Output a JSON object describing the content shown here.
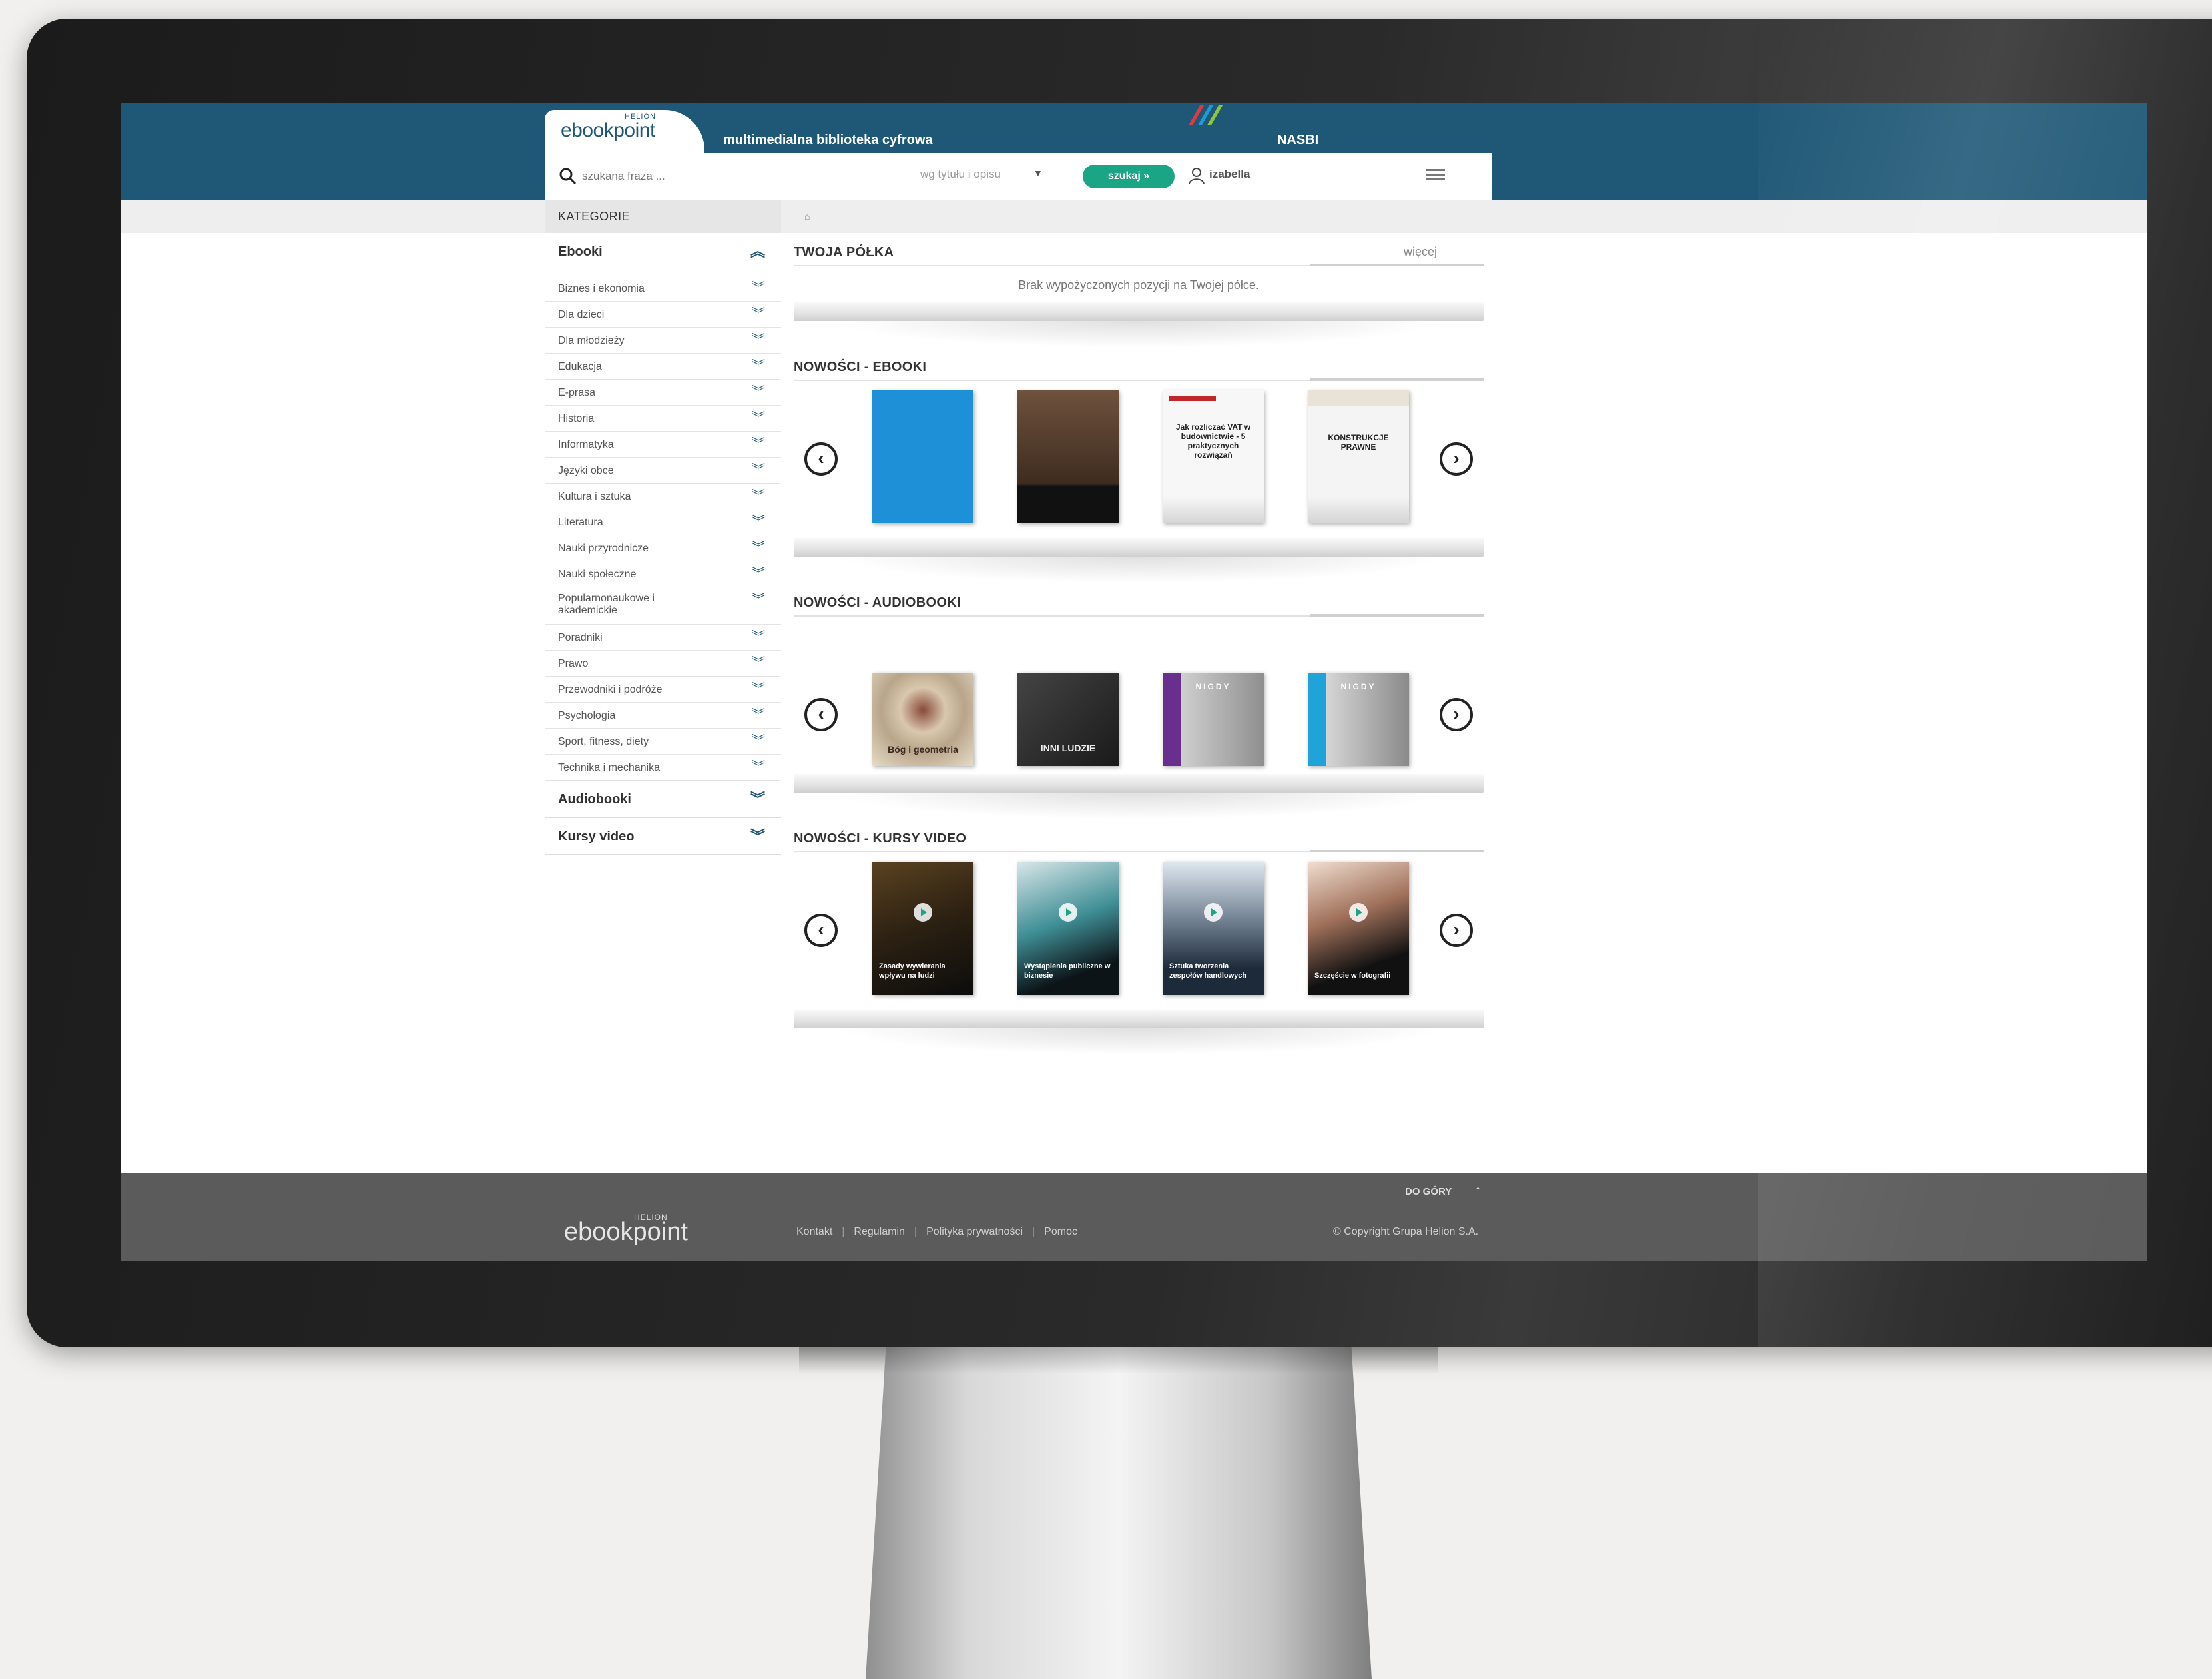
{
  "header": {
    "helion_mark": "HELION",
    "logo": "ebookpoint",
    "tagline": "multimedialna biblioteka cyfrowa",
    "org": "NASBI",
    "accent_colors": [
      "#e03a3e",
      "#1f9ad6",
      "#8cc63f"
    ]
  },
  "search": {
    "placeholder": "szukana fraza ...",
    "scope": "wg tytułu i opisu",
    "button": "szukaj »",
    "user": "izabella"
  },
  "sidebar": {
    "title": "KATEGORIE",
    "main": "Ebooki",
    "items": [
      "Biznes i ekonomia",
      "Dla dzieci",
      "Dla młodzieży",
      "Edukacja",
      "E-prasa",
      "Historia",
      "Informatyka",
      "Języki obce",
      "Kultura i sztuka",
      "Literatura",
      "Nauki przyrodnicze",
      "Nauki społeczne",
      "Popularnonaukowe i akademickie",
      "Poradniki",
      "Prawo",
      "Przewodniki i podróże",
      "Psychologia",
      "Sport, fitness, diety",
      "Technika i mechanika"
    ],
    "audiobooks": "Audiobooki",
    "videos": "Kursy video"
  },
  "main": {
    "breadcrumb": "⌂",
    "shelf": {
      "title": "TWOJA PÓŁKA",
      "more": "więcej",
      "empty": "Brak wypożyczonych pozycji na Twojej półce."
    },
    "ebooks": {
      "title": "NOWOŚCI - EBOOKI",
      "covers": [
        {
          "text": "",
          "color": "#1e90d8"
        },
        {
          "text": "",
          "color": "#5a3f2e"
        },
        {
          "text": "Jak rozliczać VAT w budownictwie - 5 praktycznych rozwiązań",
          "color": "#f4f4f4"
        },
        {
          "text": "KONSTRUKCJE PRAWNE",
          "color": "#f2f2f2"
        }
      ]
    },
    "audiobooks": {
      "title": "NOWOŚCI - AUDIOBOOKI",
      "covers": [
        {
          "text": "Bóg i geometria",
          "color": "#d9c8ad"
        },
        {
          "text": "INNI LUDZIE",
          "color": "#222222"
        },
        {
          "text": "NIGDY",
          "color": "#6a2f8e"
        },
        {
          "text": "NIGDY",
          "color": "#1fa3d8"
        }
      ]
    },
    "videos": {
      "title": "NOWOŚCI - KURSY VIDEO",
      "covers": [
        {
          "text": "Zasady wywierania wpływu na ludzi",
          "color": "#2b2012"
        },
        {
          "text": "Wystąpienia publiczne w biznesie",
          "color": "#1c6a74"
        },
        {
          "text": "Sztuka tworzenia zespołów handlowych",
          "color": "#2a3d57"
        },
        {
          "text": "Szczęście w fotografii",
          "color": "#333333"
        }
      ]
    }
  },
  "footer": {
    "helion_mark": "HELION",
    "logo": "ebookpoint",
    "links": [
      "Kontakt",
      "Regulamin",
      "Polityka prywatności",
      "Pomoc"
    ],
    "back_to_top": "DO GÓRY",
    "copyright": "© Copyright Grupa Helion S.A."
  }
}
